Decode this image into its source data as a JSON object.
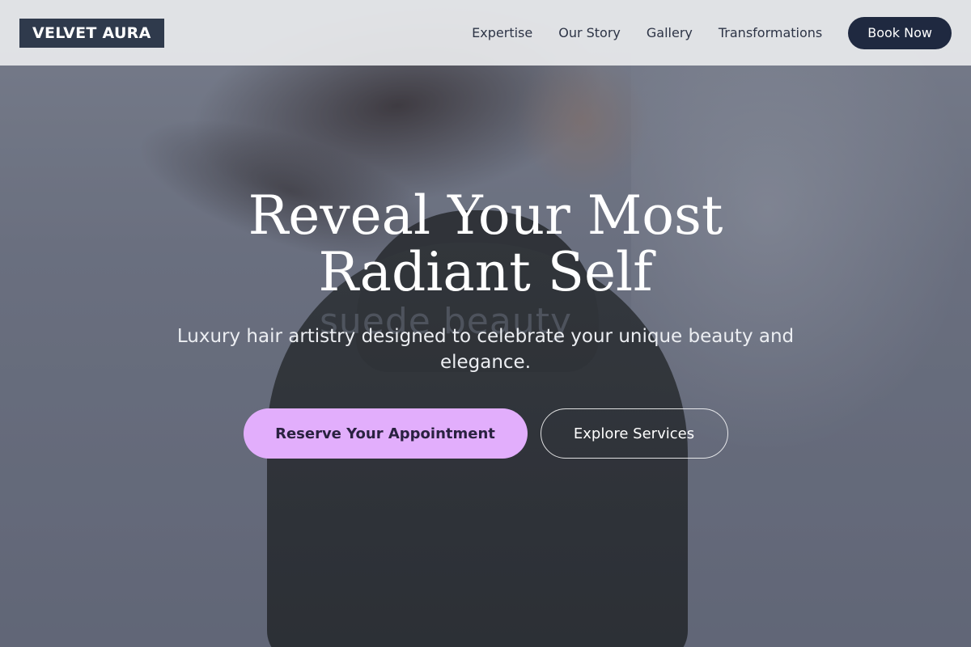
{
  "brand": {
    "logo_text": "VELVET AURA"
  },
  "nav": {
    "items": [
      {
        "label": "Expertise"
      },
      {
        "label": "Our Story"
      },
      {
        "label": "Gallery"
      },
      {
        "label": "Transformations"
      }
    ],
    "book_label": "Book Now"
  },
  "hero": {
    "title": "Reveal Your Most Radiant Self",
    "subtitle": "Luxury hair artistry designed to celebrate your unique beauty and elegance.",
    "primary_cta": "Reserve Your Appointment",
    "secondary_cta": "Explore Services",
    "background_watermark": "suede beauty"
  },
  "colors": {
    "accent": "#e2aefc",
    "dark": "#1f2940",
    "logo_bg": "#2f3a4c"
  }
}
